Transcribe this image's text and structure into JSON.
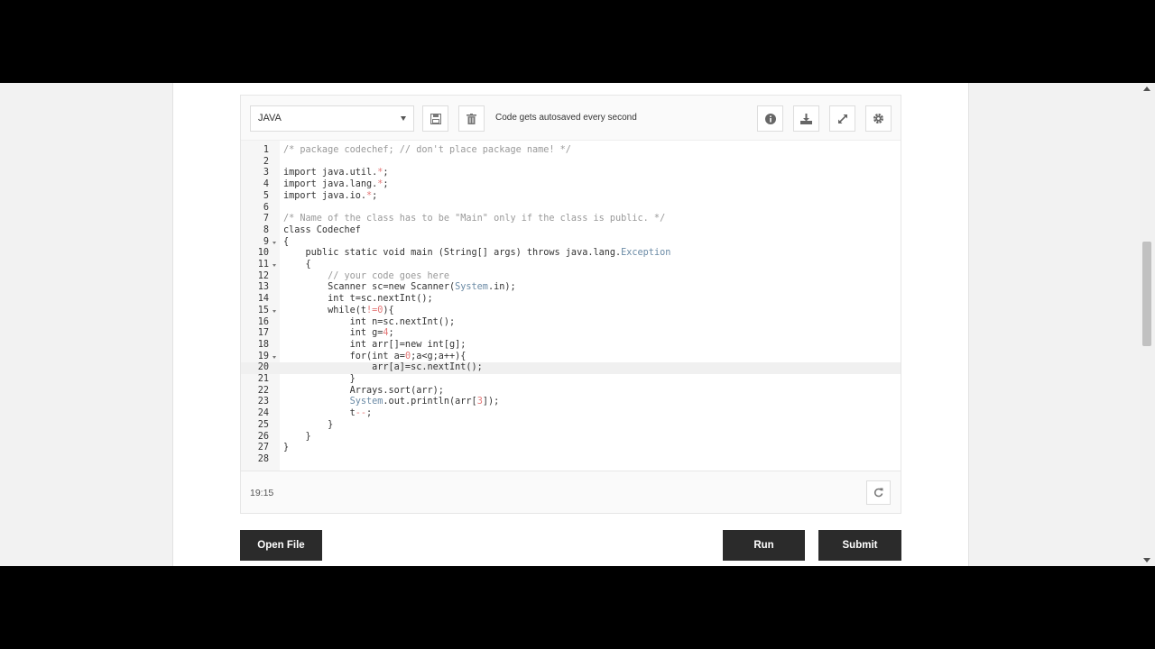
{
  "toolbar": {
    "language": "JAVA",
    "autosave_text": "Code gets autosaved every second",
    "icons": [
      "save-icon",
      "trash-icon",
      "info-icon",
      "download-icon",
      "expand-icon",
      "gear-icon"
    ]
  },
  "editor": {
    "lines": [
      {
        "n": "1",
        "html": "<span class=\"cmt\">/* package codechef; // don't place package name! */</span>"
      },
      {
        "n": "2",
        "html": ""
      },
      {
        "n": "3",
        "html": "import java.util.<span class=\"num\">*</span>;"
      },
      {
        "n": "4",
        "html": "import java.lang.<span class=\"num\">*</span>;"
      },
      {
        "n": "5",
        "html": "import java.io.<span class=\"num\">*</span>;"
      },
      {
        "n": "6",
        "html": ""
      },
      {
        "n": "7",
        "html": "<span class=\"cmt\">/* Name of the class has to be \"Main\" only if the class is public. */</span>"
      },
      {
        "n": "8",
        "html": "class Codechef"
      },
      {
        "n": "9",
        "fold": true,
        "html": "{"
      },
      {
        "n": "10",
        "html": "    public static void main (String[] args) throws java.lang.<span class=\"typ\">Exception</span>"
      },
      {
        "n": "11",
        "fold": true,
        "html": "    {"
      },
      {
        "n": "12",
        "html": "        <span class=\"cmt\">// your code goes here</span>"
      },
      {
        "n": "13",
        "html": "        Scanner sc=new Scanner(<span class=\"typ\">System</span>.in);"
      },
      {
        "n": "14",
        "html": "        int t=sc.nextInt();"
      },
      {
        "n": "15",
        "fold": true,
        "html": "        while(t<span class=\"num\">!=0</span>){"
      },
      {
        "n": "16",
        "html": "            int n=sc.nextInt();"
      },
      {
        "n": "17",
        "html": "            int g=<span class=\"num\">4</span>;"
      },
      {
        "n": "18",
        "html": "            int arr[]=new int[g];"
      },
      {
        "n": "19",
        "fold": true,
        "html": "            for(int a=<span class=\"num\">0</span>;a&lt;g;a++){"
      },
      {
        "n": "20",
        "active": true,
        "html": "                arr[a]=sc.nextInt();"
      },
      {
        "n": "21",
        "html": "            }"
      },
      {
        "n": "22",
        "html": "            Arrays.sort(arr);"
      },
      {
        "n": "23",
        "html": "            <span class=\"typ\">System</span>.out.println(arr[<span class=\"num\">3</span>]);"
      },
      {
        "n": "24",
        "html": "            t<span class=\"num\">--</span>;"
      },
      {
        "n": "25",
        "html": "        }"
      },
      {
        "n": "26",
        "html": "    }"
      },
      {
        "n": "27",
        "html": "}"
      },
      {
        "n": "28",
        "html": ""
      }
    ]
  },
  "status": {
    "cursor": "19:15"
  },
  "actions": {
    "open_file": "Open File",
    "run": "Run",
    "submit": "Submit"
  }
}
